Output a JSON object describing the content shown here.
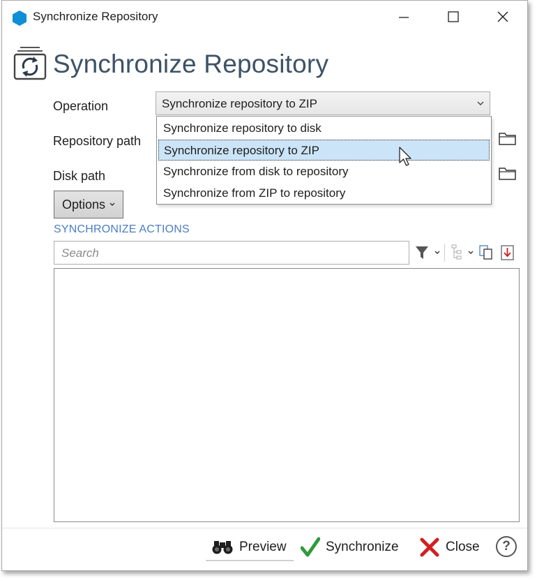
{
  "window": {
    "title": "Synchronize Repository",
    "minimize_icon": "minimize-icon",
    "maximize_icon": "maximize-icon",
    "close_icon": "close-icon"
  },
  "header": {
    "title": "Synchronize Repository",
    "icon": "sync-repository-icon"
  },
  "form": {
    "operation_label": "Operation",
    "operation_value": "Synchronize repository to ZIP",
    "repository_path_label": "Repository path",
    "disk_path_label": "Disk path",
    "operation_options": [
      "Synchronize repository to disk",
      "Synchronize repository to ZIP",
      "Synchronize from disk to repository",
      "Synchronize from ZIP to repository"
    ],
    "selected_option": "Synchronize repository to ZIP"
  },
  "options_button": {
    "label": "Options"
  },
  "actions": {
    "section_label": "SYNCHRONIZE ACTIONS",
    "search_placeholder": "Search"
  },
  "footer": {
    "preview_label": "Preview",
    "synchronize_label": "Synchronize",
    "close_label": "Close",
    "help_label": "?"
  },
  "colors": {
    "header_text": "#3d5266",
    "section_label": "#4a7fc0",
    "selection_bg": "#cce4f7",
    "check_green": "#2e9a3a",
    "close_red": "#d21f1f",
    "app_icon": "#0e8fd6"
  }
}
